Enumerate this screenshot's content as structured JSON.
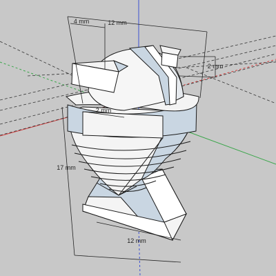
{
  "viewport": {
    "background": "#c8c8c8",
    "model_fill_light": "#f4f4f4",
    "model_fill_blue": "#c9d6e2",
    "edge_color": "#1a1a1a",
    "axis_colors": {
      "red": "#d23a3a",
      "green": "#3aa64a",
      "blue": "#3a4fd2"
    }
  },
  "dimensions": {
    "top_width": "12 mm",
    "tab_width": "4 mm",
    "tab_height": "2 mm",
    "ring_offset": "2 mm",
    "overall_height": "17 mm",
    "base_width": "12 mm"
  }
}
